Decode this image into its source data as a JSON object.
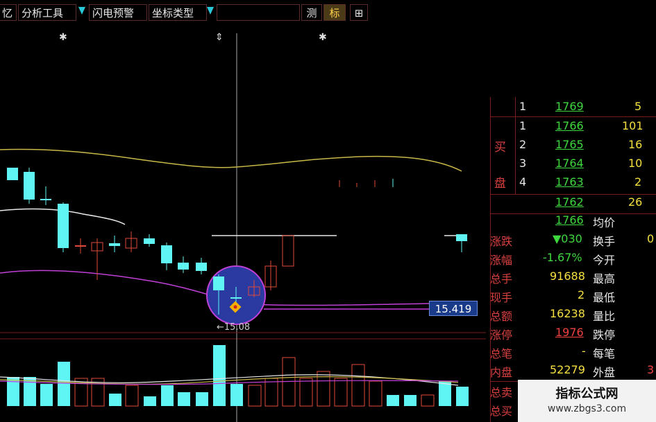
{
  "toolbar": {
    "item_memory": "忆",
    "analysis_tools": "分析工具",
    "flash_alert": "闪电预警",
    "coord_type": "坐标类型",
    "measure": "测",
    "mark": "标",
    "plus": "⊞"
  },
  "chart": {
    "price_tag": "15.419",
    "low_label": "←15.08",
    "star_marker": "✱",
    "colors": {
      "up": "#e04a3a",
      "down": "#5ff5f5",
      "ma_yellow": "#c8b848",
      "ma_white": "#e8e8e8",
      "ma_magenta": "#c040d8",
      "highlight_circle": "#2a3aa0"
    }
  },
  "order_book": {
    "side_label_buy_1": "买",
    "side_label_buy_2": "盘",
    "rows": [
      {
        "level": "1",
        "price": "1769",
        "vol": "5"
      },
      {
        "level": "1",
        "price": "1766",
        "vol": "101"
      },
      {
        "level": "2",
        "price": "1765",
        "vol": "16"
      },
      {
        "level": "3",
        "price": "1764",
        "vol": "10"
      },
      {
        "level": "4",
        "price": "1763",
        "vol": "2"
      },
      {
        "level": "",
        "price": "1762",
        "vol": "26"
      }
    ]
  },
  "stats": [
    {
      "label": "",
      "value": "1766",
      "label2": "均价",
      "value2": ""
    },
    {
      "label": "涨跌",
      "value": "▼030",
      "label2": "换手",
      "value2": "0"
    },
    {
      "label": "涨幅",
      "value": "-1.67%",
      "label2": "今开",
      "value2": ""
    },
    {
      "label": "总手",
      "value": "91688",
      "label2": "最高",
      "value2": ""
    },
    {
      "label": "现手",
      "value": "2",
      "label2": "最低",
      "value2": ""
    },
    {
      "label": "总额",
      "value": "16238",
      "label2": "量比",
      "value2": ""
    },
    {
      "label": "涨停",
      "value": "1976",
      "label2": "跌停",
      "value2": ""
    },
    {
      "label": "总笔",
      "value": "-",
      "label2": "每笔",
      "value2": ""
    },
    {
      "label": "内盘",
      "value": "52279",
      "label2": "外盘",
      "value2": "3"
    },
    {
      "label": "总卖",
      "value": "",
      "label2": "",
      "value2": ""
    },
    {
      "label": "总买",
      "value": "",
      "label2": "",
      "value2": ""
    }
  ],
  "watermark": {
    "title": "指标公式网",
    "url": "www.zbgs3.com"
  }
}
